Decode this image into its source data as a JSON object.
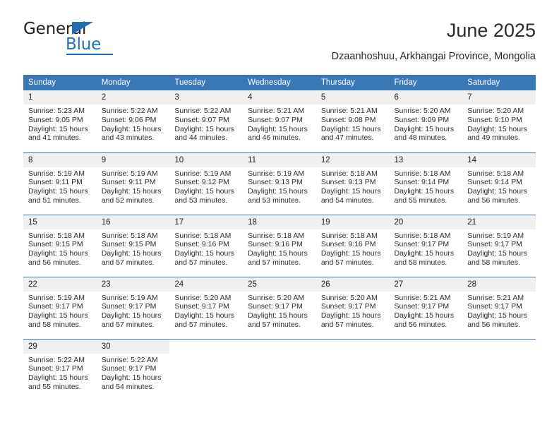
{
  "brand": {
    "name_dark": "General",
    "name_blue": "Blue",
    "accent_color": "#1f6eb5"
  },
  "header": {
    "title": "June 2025",
    "subtitle": "Dzaanhoshuu, Arkhangai Province, Mongolia",
    "header_bg": "#3a78b5"
  },
  "calendar": {
    "weekday_headers": [
      "Sunday",
      "Monday",
      "Tuesday",
      "Wednesday",
      "Thursday",
      "Friday",
      "Saturday"
    ],
    "weeks": [
      [
        {
          "day": "1",
          "sunrise": "Sunrise: 5:23 AM",
          "sunset": "Sunset: 9:05 PM",
          "daylight_line1": "Daylight: 15 hours",
          "daylight_line2": "and 41 minutes."
        },
        {
          "day": "2",
          "sunrise": "Sunrise: 5:22 AM",
          "sunset": "Sunset: 9:06 PM",
          "daylight_line1": "Daylight: 15 hours",
          "daylight_line2": "and 43 minutes."
        },
        {
          "day": "3",
          "sunrise": "Sunrise: 5:22 AM",
          "sunset": "Sunset: 9:07 PM",
          "daylight_line1": "Daylight: 15 hours",
          "daylight_line2": "and 44 minutes."
        },
        {
          "day": "4",
          "sunrise": "Sunrise: 5:21 AM",
          "sunset": "Sunset: 9:07 PM",
          "daylight_line1": "Daylight: 15 hours",
          "daylight_line2": "and 46 minutes."
        },
        {
          "day": "5",
          "sunrise": "Sunrise: 5:21 AM",
          "sunset": "Sunset: 9:08 PM",
          "daylight_line1": "Daylight: 15 hours",
          "daylight_line2": "and 47 minutes."
        },
        {
          "day": "6",
          "sunrise": "Sunrise: 5:20 AM",
          "sunset": "Sunset: 9:09 PM",
          "daylight_line1": "Daylight: 15 hours",
          "daylight_line2": "and 48 minutes."
        },
        {
          "day": "7",
          "sunrise": "Sunrise: 5:20 AM",
          "sunset": "Sunset: 9:10 PM",
          "daylight_line1": "Daylight: 15 hours",
          "daylight_line2": "and 49 minutes."
        }
      ],
      [
        {
          "day": "8",
          "sunrise": "Sunrise: 5:19 AM",
          "sunset": "Sunset: 9:11 PM",
          "daylight_line1": "Daylight: 15 hours",
          "daylight_line2": "and 51 minutes."
        },
        {
          "day": "9",
          "sunrise": "Sunrise: 5:19 AM",
          "sunset": "Sunset: 9:11 PM",
          "daylight_line1": "Daylight: 15 hours",
          "daylight_line2": "and 52 minutes."
        },
        {
          "day": "10",
          "sunrise": "Sunrise: 5:19 AM",
          "sunset": "Sunset: 9:12 PM",
          "daylight_line1": "Daylight: 15 hours",
          "daylight_line2": "and 53 minutes."
        },
        {
          "day": "11",
          "sunrise": "Sunrise: 5:19 AM",
          "sunset": "Sunset: 9:13 PM",
          "daylight_line1": "Daylight: 15 hours",
          "daylight_line2": "and 53 minutes."
        },
        {
          "day": "12",
          "sunrise": "Sunrise: 5:18 AM",
          "sunset": "Sunset: 9:13 PM",
          "daylight_line1": "Daylight: 15 hours",
          "daylight_line2": "and 54 minutes."
        },
        {
          "day": "13",
          "sunrise": "Sunrise: 5:18 AM",
          "sunset": "Sunset: 9:14 PM",
          "daylight_line1": "Daylight: 15 hours",
          "daylight_line2": "and 55 minutes."
        },
        {
          "day": "14",
          "sunrise": "Sunrise: 5:18 AM",
          "sunset": "Sunset: 9:14 PM",
          "daylight_line1": "Daylight: 15 hours",
          "daylight_line2": "and 56 minutes."
        }
      ],
      [
        {
          "day": "15",
          "sunrise": "Sunrise: 5:18 AM",
          "sunset": "Sunset: 9:15 PM",
          "daylight_line1": "Daylight: 15 hours",
          "daylight_line2": "and 56 minutes."
        },
        {
          "day": "16",
          "sunrise": "Sunrise: 5:18 AM",
          "sunset": "Sunset: 9:15 PM",
          "daylight_line1": "Daylight: 15 hours",
          "daylight_line2": "and 57 minutes."
        },
        {
          "day": "17",
          "sunrise": "Sunrise: 5:18 AM",
          "sunset": "Sunset: 9:16 PM",
          "daylight_line1": "Daylight: 15 hours",
          "daylight_line2": "and 57 minutes."
        },
        {
          "day": "18",
          "sunrise": "Sunrise: 5:18 AM",
          "sunset": "Sunset: 9:16 PM",
          "daylight_line1": "Daylight: 15 hours",
          "daylight_line2": "and 57 minutes."
        },
        {
          "day": "19",
          "sunrise": "Sunrise: 5:18 AM",
          "sunset": "Sunset: 9:16 PM",
          "daylight_line1": "Daylight: 15 hours",
          "daylight_line2": "and 57 minutes."
        },
        {
          "day": "20",
          "sunrise": "Sunrise: 5:18 AM",
          "sunset": "Sunset: 9:17 PM",
          "daylight_line1": "Daylight: 15 hours",
          "daylight_line2": "and 58 minutes."
        },
        {
          "day": "21",
          "sunrise": "Sunrise: 5:19 AM",
          "sunset": "Sunset: 9:17 PM",
          "daylight_line1": "Daylight: 15 hours",
          "daylight_line2": "and 58 minutes."
        }
      ],
      [
        {
          "day": "22",
          "sunrise": "Sunrise: 5:19 AM",
          "sunset": "Sunset: 9:17 PM",
          "daylight_line1": "Daylight: 15 hours",
          "daylight_line2": "and 58 minutes."
        },
        {
          "day": "23",
          "sunrise": "Sunrise: 5:19 AM",
          "sunset": "Sunset: 9:17 PM",
          "daylight_line1": "Daylight: 15 hours",
          "daylight_line2": "and 57 minutes."
        },
        {
          "day": "24",
          "sunrise": "Sunrise: 5:20 AM",
          "sunset": "Sunset: 9:17 PM",
          "daylight_line1": "Daylight: 15 hours",
          "daylight_line2": "and 57 minutes."
        },
        {
          "day": "25",
          "sunrise": "Sunrise: 5:20 AM",
          "sunset": "Sunset: 9:17 PM",
          "daylight_line1": "Daylight: 15 hours",
          "daylight_line2": "and 57 minutes."
        },
        {
          "day": "26",
          "sunrise": "Sunrise: 5:20 AM",
          "sunset": "Sunset: 9:17 PM",
          "daylight_line1": "Daylight: 15 hours",
          "daylight_line2": "and 57 minutes."
        },
        {
          "day": "27",
          "sunrise": "Sunrise: 5:21 AM",
          "sunset": "Sunset: 9:17 PM",
          "daylight_line1": "Daylight: 15 hours",
          "daylight_line2": "and 56 minutes."
        },
        {
          "day": "28",
          "sunrise": "Sunrise: 5:21 AM",
          "sunset": "Sunset: 9:17 PM",
          "daylight_line1": "Daylight: 15 hours",
          "daylight_line2": "and 56 minutes."
        }
      ],
      [
        {
          "day": "29",
          "sunrise": "Sunrise: 5:22 AM",
          "sunset": "Sunset: 9:17 PM",
          "daylight_line1": "Daylight: 15 hours",
          "daylight_line2": "and 55 minutes."
        },
        {
          "day": "30",
          "sunrise": "Sunrise: 5:22 AM",
          "sunset": "Sunset: 9:17 PM",
          "daylight_line1": "Daylight: 15 hours",
          "daylight_line2": "and 54 minutes."
        },
        {
          "day": "",
          "sunrise": "",
          "sunset": "",
          "daylight_line1": "",
          "daylight_line2": ""
        },
        {
          "day": "",
          "sunrise": "",
          "sunset": "",
          "daylight_line1": "",
          "daylight_line2": ""
        },
        {
          "day": "",
          "sunrise": "",
          "sunset": "",
          "daylight_line1": "",
          "daylight_line2": ""
        },
        {
          "day": "",
          "sunrise": "",
          "sunset": "",
          "daylight_line1": "",
          "daylight_line2": ""
        },
        {
          "day": "",
          "sunrise": "",
          "sunset": "",
          "daylight_line1": "",
          "daylight_line2": ""
        }
      ]
    ]
  }
}
